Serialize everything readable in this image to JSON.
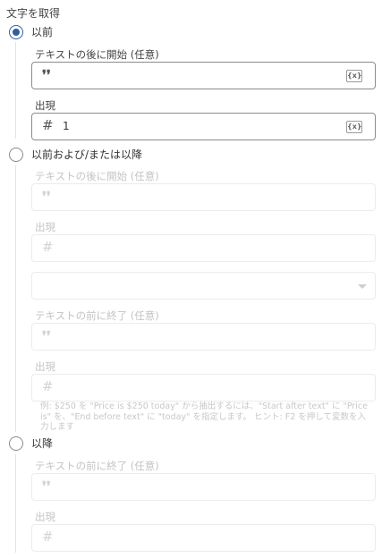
{
  "title": "文字を取得",
  "options": {
    "before": {
      "label": "以前",
      "checked": true
    },
    "before_and_after": {
      "label": "以前および/または以降",
      "checked": false
    },
    "after": {
      "label": "以降",
      "checked": false
    }
  },
  "before_section": {
    "start_after_label": "テキストの後に開始 (任意)",
    "start_after_value": "",
    "occurrence_label": "出現",
    "occurrence_value": "1"
  },
  "both_section": {
    "start_after_label": "テキストの後に開始 (任意)",
    "occurrence1_label": "出現",
    "dropdown_value": "",
    "end_before_label": "テキストの前に終了 (任意)",
    "occurrence2_label": "出現",
    "help_text": "例: $250 を \"Price is $250 today\" から抽出するには、\"Start after text\" に \"Price is\" を、\"End before text\" に \"today\" を指定します。 ヒント: F2 を押して変数を入力します"
  },
  "after_section": {
    "end_before_label": "テキストの前に終了 (任意)",
    "occurrence_label": "出現"
  },
  "icons": {
    "quote": "❜❜",
    "hash": "#",
    "variable": "{x}"
  }
}
